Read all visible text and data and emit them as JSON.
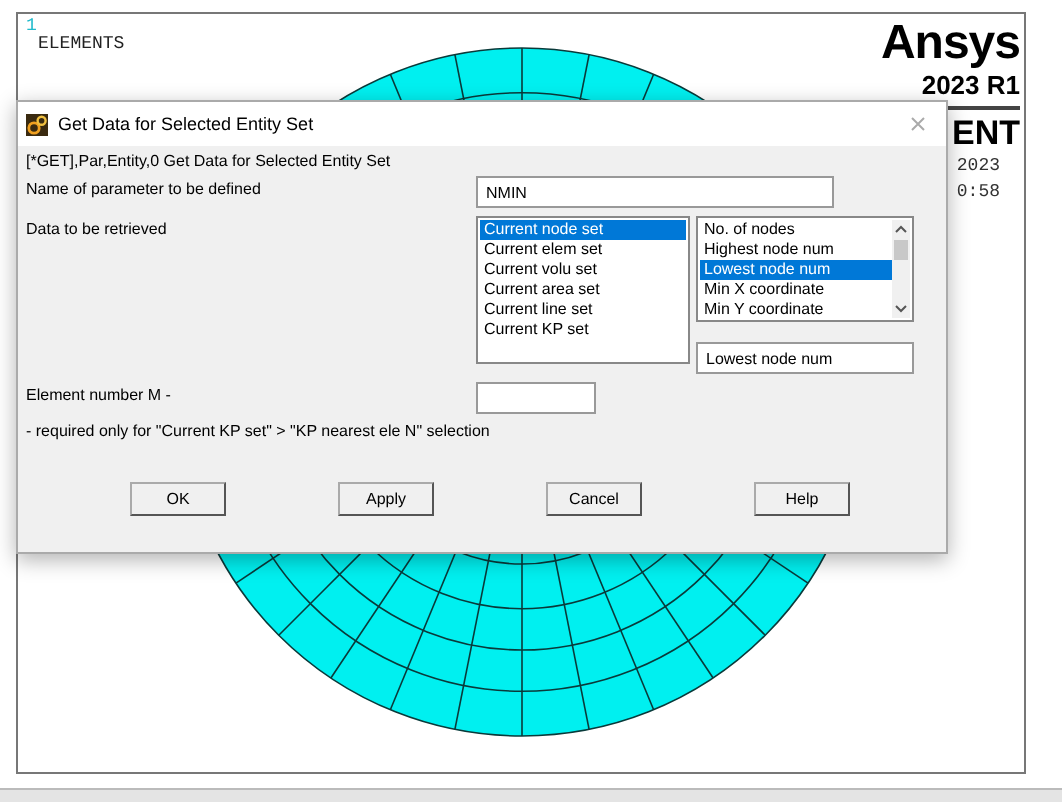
{
  "graphics": {
    "marker": "1",
    "label": "ELEMENTS",
    "logo": "Ansys",
    "version": "2023 R1",
    "heading": "ENT",
    "date": "2023",
    "time": "0:58"
  },
  "dialog": {
    "title": "Get Data for Selected Entity Set",
    "command": "[*GET],Par,Entity,0   Get Data for Selected Entity Set",
    "name_label": "Name of parameter to be defined",
    "name_value": "NMIN",
    "data_label": "Data to be retrieved",
    "entity_list": [
      {
        "label": "Current node set",
        "selected": true
      },
      {
        "label": "Current elem set",
        "selected": false
      },
      {
        "label": "Current volu set",
        "selected": false
      },
      {
        "label": "Current area set",
        "selected": false
      },
      {
        "label": "Current line set",
        "selected": false
      },
      {
        "label": "Current KP set",
        "selected": false
      }
    ],
    "item_list": [
      {
        "label": "No. of nodes",
        "selected": false
      },
      {
        "label": "Highest node num",
        "selected": false
      },
      {
        "label": "Lowest node num",
        "selected": true
      },
      {
        "label": "Min X coordinate",
        "selected": false
      },
      {
        "label": "Min Y coordinate",
        "selected": false
      }
    ],
    "item_value": "Lowest node num",
    "element_label": "Element number M -",
    "note": "- required only for \"Current KP set\" > \"KP nearest ele N\" selection",
    "buttons": [
      "OK",
      "Apply",
      "Cancel",
      "Help"
    ]
  }
}
